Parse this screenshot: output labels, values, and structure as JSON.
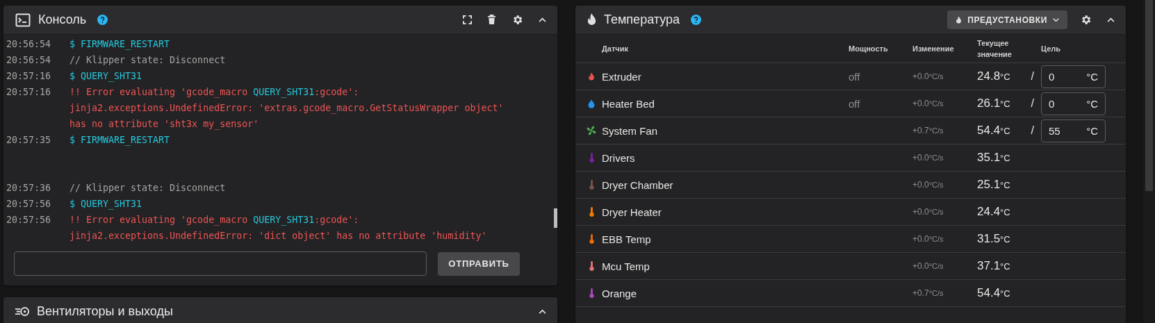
{
  "console": {
    "title": "Консоль",
    "log": [
      {
        "kind": "command",
        "time": "20:56:54",
        "lines": [
          [
            {
              "text": "$ FIRMWARE_RESTART"
            }
          ]
        ]
      },
      {
        "kind": "info",
        "time": "20:56:54",
        "lines": [
          [
            {
              "text": "// Klipper state: Disconnect",
              "highlight": false
            }
          ]
        ]
      },
      {
        "kind": "command",
        "time": "20:57:16",
        "lines": [
          [
            {
              "text": "$ QUERY_SHT31"
            }
          ]
        ]
      },
      {
        "kind": "error",
        "time": "20:57:16",
        "lines": [
          [
            {
              "text": "!! Error evaluating 'gcode_macro ",
              "highlight": false
            },
            {
              "text": "QUERY_SHT31",
              "highlight": true
            },
            {
              "text": ":gcode':",
              "highlight": false
            }
          ],
          [
            {
              "text": "jinja2.exceptions.UndefinedError: 'extras.gcode_macro.GetStatusWrapper object'",
              "highlight": false
            }
          ],
          [
            {
              "text": "has no attribute 'sht3x my_sensor'",
              "highlight": false
            }
          ]
        ]
      },
      {
        "kind": "command",
        "time": "20:57:35",
        "lines": [
          [
            {
              "text": "$ FIRMWARE_RESTART"
            }
          ]
        ]
      },
      {
        "kind": "blank"
      },
      {
        "kind": "blank"
      },
      {
        "kind": "info",
        "time": "20:57:36",
        "lines": [
          [
            {
              "text": "// Klipper state: Disconnect",
              "highlight": false
            }
          ]
        ]
      },
      {
        "kind": "command",
        "time": "20:57:56",
        "lines": [
          [
            {
              "text": "$ QUERY_SHT31"
            }
          ]
        ]
      },
      {
        "kind": "error",
        "time": "20:57:56",
        "lines": [
          [
            {
              "text": "!! Error evaluating 'gcode_macro ",
              "highlight": false
            },
            {
              "text": "QUERY_SHT31",
              "highlight": true
            },
            {
              "text": ":gcode':",
              "highlight": false
            }
          ],
          [
            {
              "text": "jinja2.exceptions.UndefinedError: 'dict object' has no attribute 'humidity'",
              "highlight": false
            }
          ]
        ]
      }
    ],
    "send_button": "ОТПРАВИТЬ"
  },
  "fans_panel": {
    "title": "Вентиляторы и выходы"
  },
  "temperature": {
    "title": "Температура",
    "presets_button": "ПРЕДУСТАНОВКИ",
    "columns": [
      "Датчик",
      "Мощность",
      "Изменение",
      "Текущее значение",
      "Цель"
    ],
    "sensors": [
      {
        "kind": "extruder",
        "color": "#ef5350",
        "name": "Extruder",
        "power": "off",
        "rate": "+0.0",
        "rate_unit": "°C/s",
        "current": "24.8",
        "unit": "°C",
        "target": {
          "separator": "/",
          "value": "0",
          "unit": "°C"
        }
      },
      {
        "kind": "bed",
        "color": "#2196f3",
        "name": "Heater Bed",
        "power": "off",
        "rate": "+0.0",
        "rate_unit": "°C/s",
        "current": "26.1",
        "unit": "°C",
        "target": {
          "separator": "/",
          "value": "0",
          "unit": "°C"
        }
      },
      {
        "kind": "fan",
        "color": "#4caf50",
        "name": "System Fan",
        "rate": "+0.7",
        "rate_unit": "°C/s",
        "current": "54.4",
        "unit": "°C",
        "target": {
          "separator": "/",
          "value": "55",
          "unit": "°C"
        }
      },
      {
        "kind": "sensor",
        "color": "#7b1fa2",
        "name": "Drivers",
        "rate": "+0.0",
        "rate_unit": "°C/s",
        "current": "35.1",
        "unit": "°C"
      },
      {
        "kind": "sensor",
        "color": "#795548",
        "name": "Dryer Chamber",
        "rate": "+0.0",
        "rate_unit": "°C/s",
        "current": "25.1",
        "unit": "°C"
      },
      {
        "kind": "sensor",
        "color": "#f57c00",
        "name": "Dryer Heater",
        "rate": "+0.0",
        "rate_unit": "°C/s",
        "current": "24.4",
        "unit": "°C"
      },
      {
        "kind": "sensor",
        "color": "#ef6c00",
        "name": "EBB Temp",
        "rate": "+0.0",
        "rate_unit": "°C/s",
        "current": "31.5",
        "unit": "°C"
      },
      {
        "kind": "sensor",
        "color": "#e57373",
        "name": "Mcu Temp",
        "rate": "+0.0",
        "rate_unit": "°C/s",
        "current": "37.1",
        "unit": "°C"
      },
      {
        "kind": "sensor",
        "color": "#ab47bc",
        "name": "Orange",
        "rate": "+0.7",
        "rate_unit": "°C/s",
        "current": "54.4",
        "unit": "°C"
      }
    ]
  }
}
